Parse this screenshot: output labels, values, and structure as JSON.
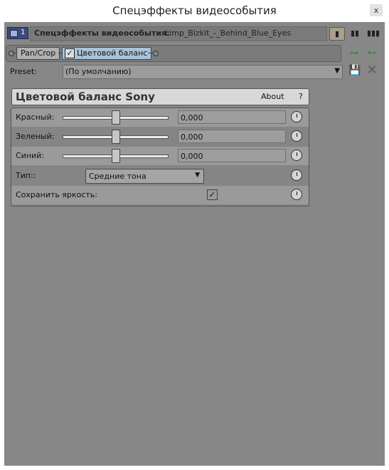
{
  "window": {
    "title": "Спецэффекты видеособытия",
    "close_label": "x"
  },
  "header": {
    "track_number": "1",
    "label": "Спецэффекты видеособытия:",
    "event_name": "Limp_Bizkit_-_Behind_Blue_Eyes",
    "view_buttons": [
      "▮",
      "▮▮",
      "▮▮▮"
    ]
  },
  "chain": {
    "plugins": [
      {
        "label": "Pan/Crop"
      },
      {
        "label": "Цветовой баланс",
        "checked": true
      }
    ],
    "right_icons": [
      "plugin-chain-icon",
      "remove-plugin-icon"
    ]
  },
  "preset": {
    "label": "Preset:",
    "value": "(По умолчанию)",
    "save_icon": "floppy-disk-icon",
    "delete_icon": "close-icon"
  },
  "plugin": {
    "title": "Цветовой баланс Sony",
    "about_label": "About",
    "help_label": "?"
  },
  "params": {
    "red": {
      "label": "Красный:",
      "value": "0,000",
      "slider_position": 0.5
    },
    "green": {
      "label": "Зеленый:",
      "value": "0,000",
      "slider_position": 0.5
    },
    "blue": {
      "label": "Синий:",
      "value": "0,000",
      "slider_position": 0.5
    },
    "type": {
      "label": "Тип::",
      "value": "Средние тона"
    },
    "keep_brightness": {
      "label": "Сохранить яркость:",
      "checked": true
    }
  }
}
